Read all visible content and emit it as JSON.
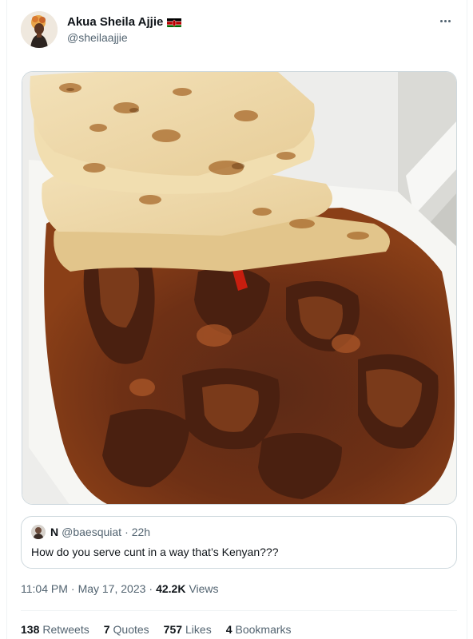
{
  "author": {
    "name": "Akua Sheila Ajjie",
    "handle": "@sheilaajjie",
    "flag_icon": "kenya-flag-icon"
  },
  "more_icon": "more-horizontal-icon",
  "photo": {
    "icon": "food-photo"
  },
  "quoted_tweet": {
    "name": "N",
    "handle": "@baesquiat",
    "separator": "·",
    "time": "22h",
    "text": "How do you serve cunt in a way that’s Kenyan???"
  },
  "meta": {
    "time": "11:04 PM",
    "sep1": "·",
    "date": "May 17, 2023",
    "sep2": "·",
    "views_count": "42.2K",
    "views_label": "Views"
  },
  "stats": {
    "retweets_count": "138",
    "retweets_label": "Retweets",
    "quotes_count": "7",
    "quotes_label": "Quotes",
    "likes_count": "757",
    "likes_label": "Likes",
    "bookmarks_count": "4",
    "bookmarks_label": "Bookmarks"
  },
  "colors": {
    "text": "#0f1419",
    "secondary": "#536471",
    "border": "#cfd9de"
  }
}
